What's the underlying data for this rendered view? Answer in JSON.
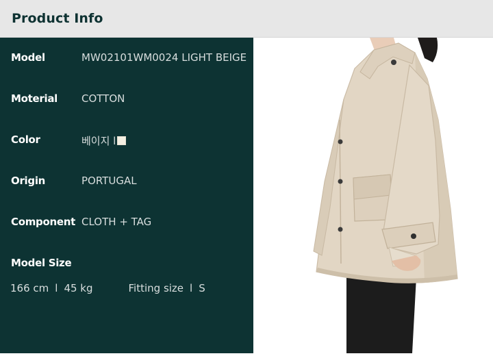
{
  "header": {
    "title": "Product Info"
  },
  "specs": [
    {
      "label": "Model",
      "value": "MW02101WM0024 LIGHT BEIGE"
    },
    {
      "label": "Moterial",
      "value": "COTTON"
    },
    {
      "label": "Color",
      "value": "베이지 l"
    },
    {
      "label": "Origin",
      "value": "PORTUGAL"
    },
    {
      "label": "Component",
      "value": "CLOTH + TAG"
    }
  ],
  "model_size": {
    "label": "Model Size",
    "height": "166 cm",
    "sep": "l",
    "weight": "45 kg",
    "fitting_label": "Fitting size",
    "fitting_sep": "l",
    "fitting_value": "S"
  },
  "colors": {
    "header_bg": "#e7e7e7",
    "panel_bg": "#0d3333",
    "swatch": "#f3efe2",
    "jacket": "#e2d6c4"
  },
  "image": {
    "subject": "model-in-beige-cotton-jacket"
  }
}
